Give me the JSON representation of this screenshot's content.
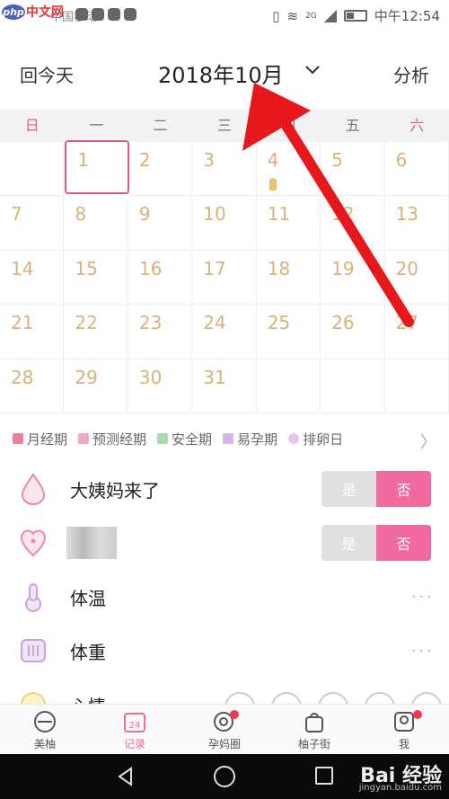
{
  "status_bar": {
    "logo_badge": "php",
    "logo_text": "中文网",
    "carrier": "中国移动",
    "signal_label": "2G",
    "time": "中午12:54"
  },
  "header": {
    "today_label": "回今天",
    "month_title": "2018年10月",
    "analyze_label": "分析"
  },
  "weekdays": [
    "日",
    "一",
    "二",
    "三",
    "四",
    "五",
    "六"
  ],
  "calendar": {
    "first_weekday_index": 1,
    "days_in_month": 31,
    "selected_day": 1,
    "days": [
      "1",
      "2",
      "3",
      "4",
      "5",
      "6",
      "7",
      "8",
      "9",
      "10",
      "11",
      "12",
      "13",
      "14",
      "15",
      "16",
      "17",
      "18",
      "19",
      "20",
      "21",
      "22",
      "23",
      "24",
      "25",
      "26",
      "27",
      "28",
      "29",
      "30",
      "31"
    ]
  },
  "legend": [
    {
      "label": "月经期",
      "color": "#e8829a"
    },
    {
      "label": "预测经期",
      "color": "#f2a8c0"
    },
    {
      "label": "安全期",
      "color": "#a8d8b0"
    },
    {
      "label": "易孕期",
      "color": "#d8b4e8"
    },
    {
      "label": "排卵日",
      "color": "#e6c8ec"
    }
  ],
  "rows": {
    "period": {
      "label": "大姨妈来了",
      "yes": "是",
      "no": "否"
    },
    "love": {
      "yes": "是",
      "no": "否"
    },
    "temperature": {
      "label": "体温",
      "more": "···"
    },
    "weight": {
      "label": "体重",
      "more": "···"
    },
    "mood": {
      "label": "心情"
    }
  },
  "tabs": [
    {
      "label": "美柚"
    },
    {
      "label": "记录",
      "icon_text": "24"
    },
    {
      "label": "孕妈圈"
    },
    {
      "label": "柚子街"
    },
    {
      "label": "我"
    }
  ],
  "watermark": {
    "main": "Bai 经验",
    "sub": "jingyan.baidu.com"
  },
  "colors": {
    "accent_pink": "#f06aa0",
    "day_text": "#d9b27a",
    "arrow_red": "#e8171c"
  }
}
